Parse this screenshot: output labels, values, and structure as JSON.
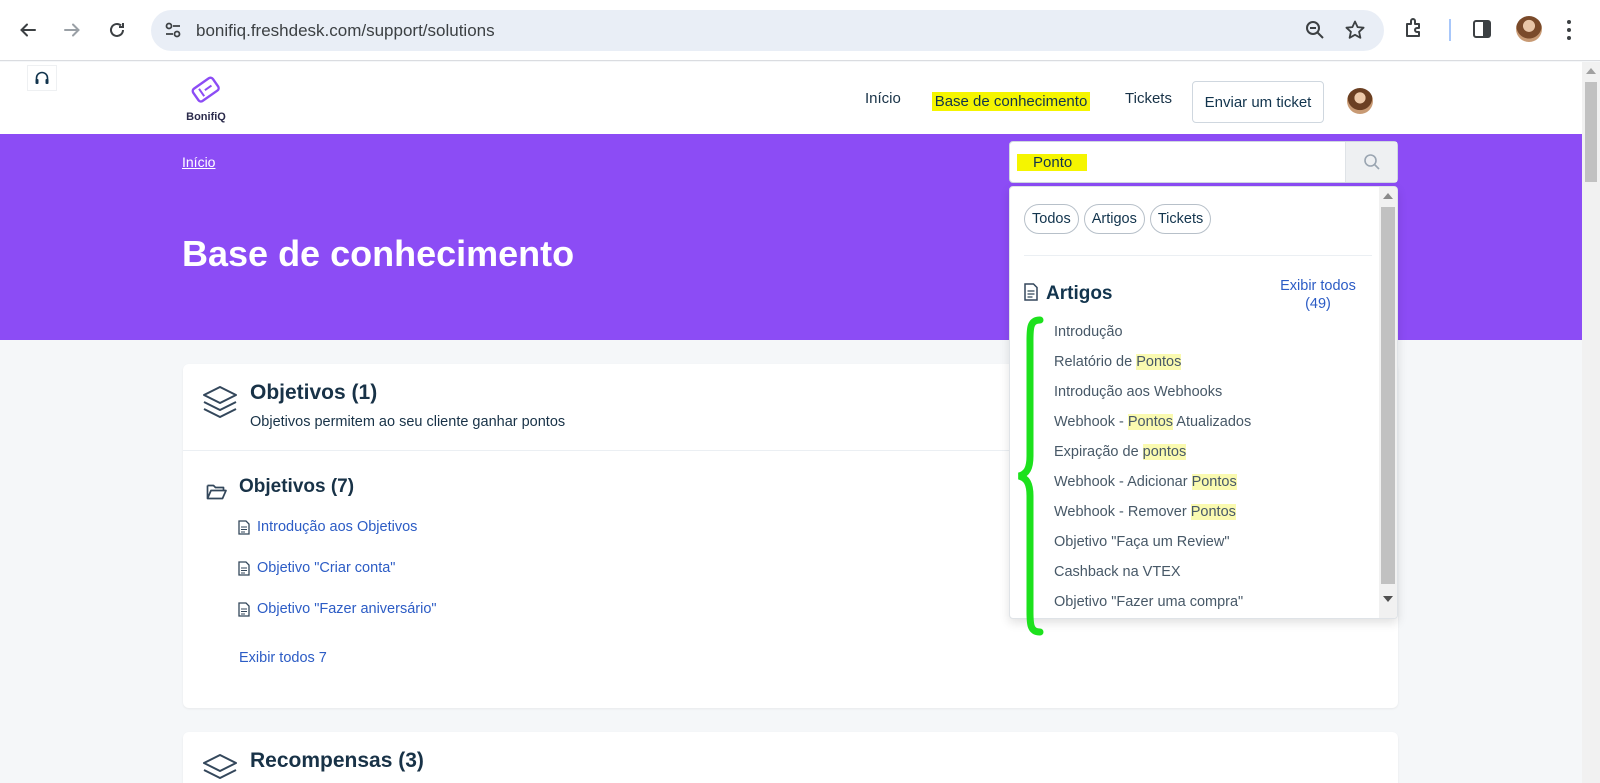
{
  "browser": {
    "url": "bonifiq.freshdesk.com/support/solutions"
  },
  "site": {
    "logo_text": "BonifiQ",
    "nav": {
      "inicio": "Início",
      "kb": "Base de conhecimento",
      "tickets": "Tickets",
      "send_ticket": "Enviar um ticket"
    }
  },
  "hero": {
    "breadcrumb": "Início",
    "title": "Base de conhecimento",
    "search_value": "Ponto"
  },
  "dropdown": {
    "chips": [
      "Todos",
      "Artigos",
      "Tickets"
    ],
    "section_title": "Artigos",
    "show_all_line1": "Exibir todos",
    "show_all_line2": "(49)",
    "items": [
      {
        "pre": "Introdução",
        "hl": "",
        "post": ""
      },
      {
        "pre": "Relatório de ",
        "hl": "Pontos",
        "post": ""
      },
      {
        "pre": "Introdução aos Webhooks",
        "hl": "",
        "post": ""
      },
      {
        "pre": "Webhook - ",
        "hl": "Pontos",
        "post": " Atualizados"
      },
      {
        "pre": "Expiração de ",
        "hl": "pontos",
        "post": ""
      },
      {
        "pre": "Webhook - Adicionar ",
        "hl": "Pontos",
        "post": ""
      },
      {
        "pre": "Webhook - Remover ",
        "hl": "Pontos",
        "post": ""
      },
      {
        "pre": "Objetivo \"Faça um Review\"",
        "hl": "",
        "post": ""
      },
      {
        "pre": "Cashback na VTEX",
        "hl": "",
        "post": ""
      },
      {
        "pre": "Objetivo \"Fazer uma compra\"",
        "hl": "",
        "post": ""
      }
    ]
  },
  "categories": [
    {
      "title": "Objetivos (1)",
      "description": "Objetivos permitem ao seu cliente ganhar pontos",
      "folder_title": "Objetivos (7)",
      "articles": [
        "Introdução aos Objetivos",
        "Objetivo \"Criar conta\"",
        "Objetivo \"Fazer aniversário\""
      ],
      "show_all": "Exibir todos 7"
    },
    {
      "title": "Recompensas (3)"
    }
  ],
  "colors": {
    "hero": "#8c4cf5",
    "highlight": "#f5f500",
    "link": "#2c5cc5",
    "annotation": "#1de11d"
  }
}
